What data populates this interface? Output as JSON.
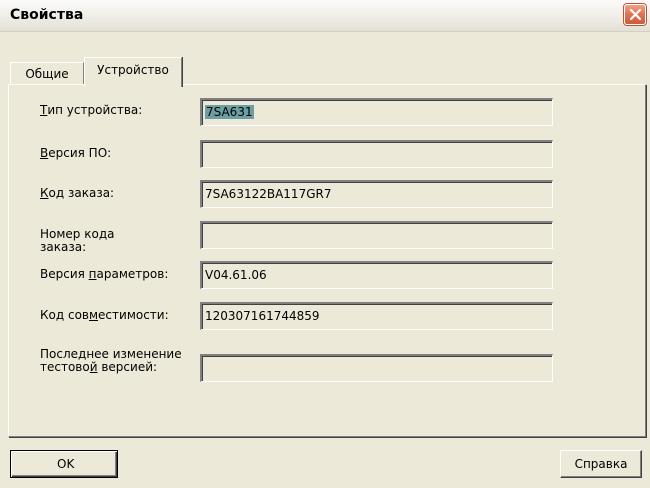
{
  "window": {
    "title": "Свойства"
  },
  "tabs": [
    {
      "label": "Общие",
      "active": false
    },
    {
      "label": "Устройство",
      "active": true
    }
  ],
  "fields": {
    "device_type": {
      "label_underlined": "Т",
      "label_rest": "ип устройства:",
      "value": "7SA631",
      "value_selected": true
    },
    "firmware_version": {
      "label_underlined": "В",
      "label_rest": "ерсия ПО:",
      "value": ""
    },
    "order_code": {
      "label_underlined": "К",
      "label_rest": "од заказа:",
      "value": "7SA63122BA117GR7"
    },
    "order_code_number": {
      "label_line1_pre": "Номер ко",
      "label_line1_underlined": "д",
      "label_line1_post": "а",
      "label_line2": "заказа:",
      "value": ""
    },
    "parameter_version": {
      "label_pre": "Версия ",
      "label_underlined": "п",
      "label_post": "араметров:",
      "value": "V04.61.06"
    },
    "compatibility_code": {
      "label_pre": "Код сов",
      "label_underlined": "м",
      "label_post": "естимости:",
      "value": "120307161744859"
    },
    "last_test_change": {
      "label_line1": "Последнее изменение",
      "label_line2_pre": "тестово",
      "label_line2_underlined": "й",
      "label_line2_post": " версией:",
      "value": ""
    }
  },
  "buttons": {
    "ok": "OK",
    "help": "Справка"
  },
  "colors": {
    "dialog_bg": "#ece9d8",
    "selection": "#6aa0a4",
    "close_button": "#e07252"
  }
}
